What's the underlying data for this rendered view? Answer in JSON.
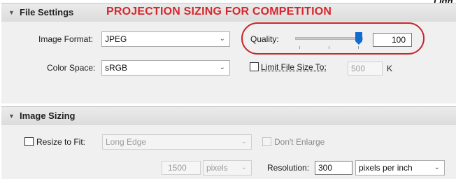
{
  "overlay": {
    "annotation": "PROJECTION SIZING FOR COMPETITION",
    "corner_text": "Ligh"
  },
  "file_settings": {
    "title": "File Settings",
    "image_format_label": "Image Format:",
    "image_format_value": "JPEG",
    "quality_label": "Quality:",
    "quality_value": "100",
    "quality_level": 100,
    "color_space_label": "Color Space:",
    "color_space_value": "sRGB",
    "limit_file_size_label": "Limit File Size To:",
    "limit_file_size_value": "500",
    "limit_file_size_unit": "K"
  },
  "image_sizing": {
    "title": "Image Sizing",
    "resize_to_fit_label": "Resize to Fit:",
    "resize_mode_value": "Long Edge",
    "dont_enlarge_label": "Don't Enlarge",
    "size_value": "1500",
    "size_unit_value": "pixels",
    "resolution_label": "Resolution:",
    "resolution_value": "300",
    "resolution_unit_value": "pixels per inch"
  },
  "icons": {
    "section_toggle": "triangle-down-icon",
    "dropdown": "chevron-down-icon",
    "checkbox": "checkbox-icon"
  },
  "colors": {
    "annotation_red": "#d7262b",
    "slider_thumb": "#0f6cd0",
    "panel_bg": "#f0f0f0"
  }
}
